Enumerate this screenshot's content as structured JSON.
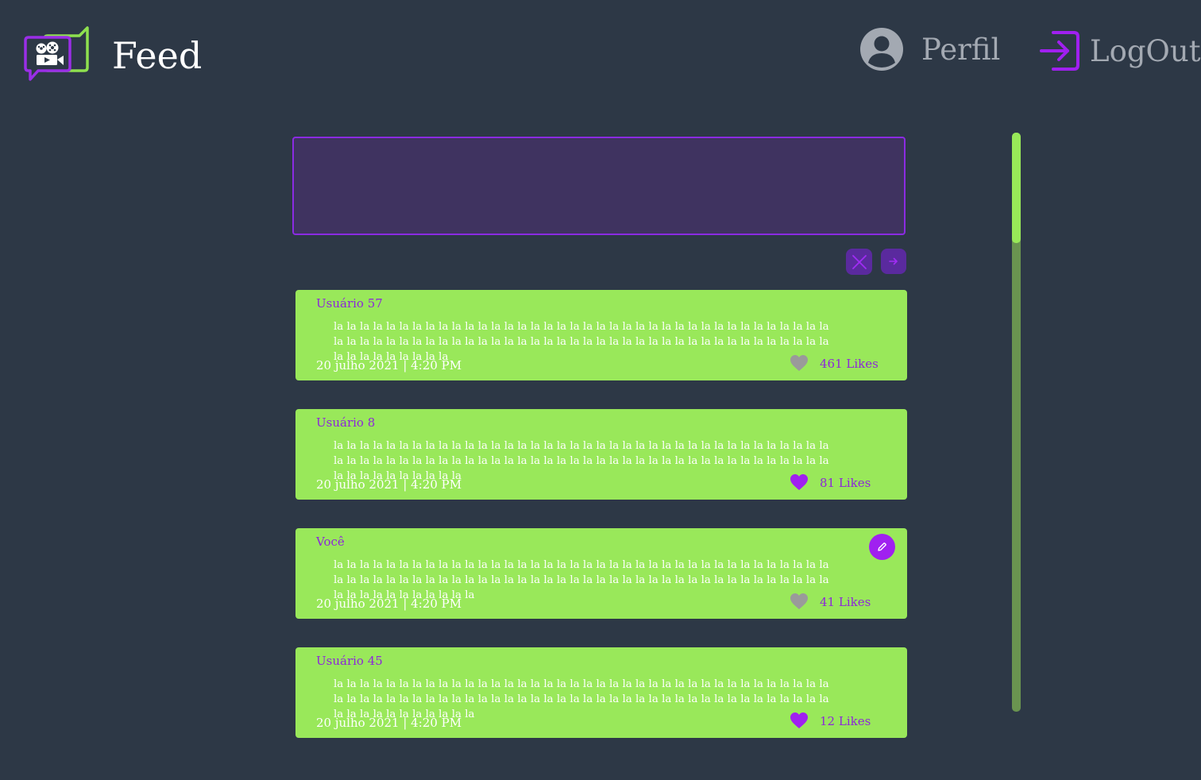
{
  "header": {
    "logo_icon": "chat-bubbles-film-camera-icon",
    "title": "Feed",
    "profile": {
      "icon": "user-circle-icon",
      "label": "Perfil"
    },
    "logout": {
      "icon": "logout-arrow-icon",
      "label": "LogOut"
    }
  },
  "composer": {
    "value": "",
    "placeholder": "",
    "cancel_icon": "close-icon",
    "send_icon": "arrow-right-icon"
  },
  "posts": [
    {
      "author": "Usuário 57",
      "text": "la la la la la la la la la la la la la la la la la la la la la la la la la la la la la la la la la la la la la la la la la la la la la la la la la la la la la la la la la la la la la la la la la la la la la la la la la la la la la la la la la la la la la",
      "date": "20 julho 2021 | 4:20 PM",
      "likes": "461 Likes",
      "liked": false,
      "editable": false
    },
    {
      "author": "Usuário 8",
      "text": "la la la la la la la la la la la la la la la la la la la la la la la la la la la la la la la la la la la la la la la la la la la la la la la la la la la la la la la la la la la la la la la la la la la la la la la la la la la la la la la la la la la la la la",
      "date": "20 julho 2021 | 4:20 PM",
      "likes": "81 Likes",
      "liked": true,
      "editable": false
    },
    {
      "author": "Você",
      "text": "la la la la la la la la la la la la la la la la la la la la la la la la la la la la la la la la la la la la la la la la la la la la la la la la la la la la la la la la la la la la la la la la la la la la la la la la la la la la la la la la la la la la la la la",
      "date": "20 julho 2021 | 4:20 PM",
      "likes": "41 Likes",
      "liked": false,
      "editable": true,
      "edit_icon": "pencil-icon"
    },
    {
      "author": "Usuário 45",
      "text": "la la la la la la la la la la la la la la la la la la la la la la la la la la la la la la la la la la la la la la la la la la la la la la la la la la la la la la la la la la la la la la la la la la la la la la la la la la la la la la la la la la la la la la la",
      "date": "20 julho 2021 | 4:20 PM",
      "likes": "12 Likes",
      "liked": true,
      "editable": false
    }
  ],
  "colors": {
    "background": "#2d3846",
    "card": "#99e85a",
    "accent": "#8d27d9",
    "liked_heart": "#a020f0",
    "unliked_heart": "#9a9a9a",
    "muted_text": "#a3a9b2"
  }
}
